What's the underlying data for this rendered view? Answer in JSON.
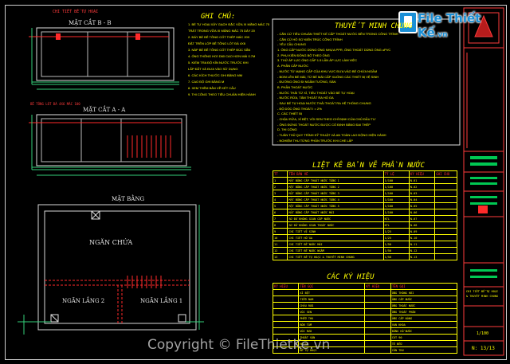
{
  "drawing": {
    "detail_heading": "CHI TIẾT BỂ TỰ HOẠI",
    "section_bb": "MẶT CẮT B - B",
    "section_aa": "MẶT CẮT A - A",
    "plan_title": "MẶT BẰNG",
    "room_main": "NGĂN CHỨA",
    "room_2": "NGĂN LẮNG 2",
    "room_1": "NGĂN LẮNG 1",
    "aa_subtitle": "BÊ TÔNG LÓT ĐÁ 4X6 MÁC 100"
  },
  "notes": {
    "heading": "GHI CHÚ:",
    "lines": [
      "1. BỂ TỰ HOẠI XÂY GẠCH ĐẶC VỮA XI MĂNG MÁC 75",
      "   TRÁT TRONG VỮA XI MĂNG MÁC 75 DÀY 20",
      "2. ĐÁY BỂ BÊ TÔNG CỐT THÉP MÁC 200",
      "   ĐẶT TRÊN LỚP BÊ TÔNG LÓT ĐÁ 4X6",
      "3. NẮP BỂ BÊ TÔNG CỐT THÉP ĐÚC SẴN",
      "4. ỐNG THÔNG HƠI D60 CAO HƠN MÁI 0.7M",
      "5. KIỂM TRA ĐỘ KÍN NƯỚC TRƯỚC KHI",
      "   LẤP ĐẤT VÀ ĐƯA VÀO SỬ DỤNG",
      "6. CÁC KÍCH THƯỚC GHI BẰNG MM",
      "7. CAO ĐỘ GHI BẰNG M",
      "8. XEM THÊM BẢN VẼ KẾT CẤU",
      "9. THI CÔNG THEO TIÊU CHUẨN HIỆN HÀNH"
    ]
  },
  "spec": {
    "heading": "THUYẾT MINH CHUNG",
    "lines": [
      "- CĂN CỨ TIÊU CHUẨN THIẾT KẾ CẤP THOÁT NƯỚC BÊN TRONG CÔNG TRÌNH",
      "- CĂN CỨ HỒ SƠ KIẾN TRÚC CÔNG TRÌNH",
      "- YÊU CẦU CHUNG",
      "1. ỐNG CẤP NƯỚC DÙNG ỐNG NHỰA PPR, ỐNG THOÁT DÙNG ỐNG uPVC",
      "2. PHỤ KIỆN ĐỒNG BỘ THEO ỐNG",
      "3. THỬ ÁP LỰC ỐNG CẤP 1.5 LẦN ÁP LỰC LÀM VIỆC",
      "A. PHẦN CẤP NƯỚC",
      "- NƯỚC TỪ MẠNG CẤP CỦA KHU VỰC ĐƯA VÀO BỂ CHỨA NGẦM",
      "- BƠM LÊN BỂ MÁI, TỪ BỂ MÁI CẤP XUỐNG CÁC THIẾT BỊ VỆ SINH",
      "- ĐƯỜNG ỐNG ĐI NGẦM TƯỜNG, SÀN",
      "B. PHẦN THOÁT NƯỚC",
      "- NƯỚC THẢI TỪ XÍ, TIỂU THOÁT VÀO BỂ TỰ HOẠI",
      "- NƯỚC RỬA, TẮM THOÁT RA HỐ GA",
      "- SAU BỂ TỰ HOẠI NƯỚC THẢI THOÁT RA HỆ THỐNG CHUNG",
      "- ĐỘ DỐC ỐNG THOÁT I = 2%",
      "C. CÁC THIẾT BỊ",
      "- CHẬU RỬA, XÍ BỆT, VÒI SEN THEO CHỈ ĐỊNH CỦA CHỦ ĐẦU TƯ",
      "- ỐNG ĐỨNG THOÁT NƯỚC ĐƯỢC CỐ ĐỊNH BẰNG ĐAI THÉP",
      "D. THI CÔNG",
      "- TUÂN THỦ QUY TRÌNH KỸ THUẬT VÀ AN TOÀN LAO ĐỘNG HIỆN HÀNH",
      "- NGHIỆM THU TỪNG PHẦN TRƯỚC KHI CHE LẤP"
    ]
  },
  "drawing_list": {
    "heading": "LIỆT KÊ BẢN VẼ PHẦN NƯỚC",
    "columns": [
      "TT",
      "TÊN BẢN VẼ",
      "TỶ LỆ",
      "KÝ HIỆU",
      "GHI CHÚ"
    ],
    "rows": [
      [
        "1",
        "MẶT BẰNG CẤP THOÁT NƯỚC TẦNG 1",
        "1/100",
        "N-01",
        ""
      ],
      [
        "2",
        "MẶT BẰNG CẤP THOÁT NƯỚC TẦNG 2",
        "1/100",
        "N-02",
        ""
      ],
      [
        "3",
        "MẶT BẰNG CẤP THOÁT NƯỚC TẦNG 3",
        "1/100",
        "N-03",
        ""
      ],
      [
        "4",
        "MẶT BẰNG CẤP THOÁT NƯỚC TẦNG 4",
        "1/100",
        "N-04",
        ""
      ],
      [
        "5",
        "MẶT BẰNG CẤP THOÁT NƯỚC TẦNG 5",
        "1/100",
        "N-05",
        ""
      ],
      [
        "6",
        "MẶT BẰNG CẤP THOÁT NƯỚC MÁI",
        "1/100",
        "N-06",
        ""
      ],
      [
        "7",
        "SƠ ĐỒ KHÔNG GIAN CẤP NƯỚC",
        "KTL",
        "N-07",
        ""
      ],
      [
        "8",
        "SƠ ĐỒ KHÔNG GIAN THOÁT NƯỚC",
        "KTL",
        "N-08",
        ""
      ],
      [
        "9",
        "CHI TIẾT VỆ SINH",
        "1/25",
        "N-09",
        ""
      ],
      [
        "10",
        "CHI TIẾT HỐ GA",
        "1/25",
        "N-10",
        ""
      ],
      [
        "11",
        "CHI TIẾT BỂ NƯỚC MÁI",
        "1/50",
        "N-11",
        ""
      ],
      [
        "12",
        "CHI TIẾT BỂ NƯỚC NGẦM",
        "1/50",
        "N-12",
        ""
      ],
      [
        "13",
        "CHI TIẾT BỂ TỰ HOẠI & THUYẾT MINH CHUNG",
        "1/50",
        "N-13",
        ""
      ]
    ]
  },
  "symbols": {
    "heading": "CÁC KÝ HIỆU",
    "columns": [
      "KÝ HIỆU",
      "TÊN GỌI",
      "KÝ HIỆU",
      "TÊN GỌI"
    ],
    "rows": [
      [
        "",
        "XÍ BỆT",
        "",
        "ỐNG THÔNG HƠI"
      ],
      [
        "",
        "TIỂU NAM",
        "",
        "ỐNG CẤP NƯỚC"
      ],
      [
        "",
        "CHẬU RỬA",
        "",
        "ỐNG THOÁT NƯỚC"
      ],
      [
        "",
        "VÒI SEN",
        "",
        "ỐNG THOÁT PHÂN"
      ],
      [
        "",
        "PHỄU THU",
        "",
        "ỐNG CẤP NÓNG"
      ],
      [
        "",
        "BỒN TẮM",
        "",
        "VAN KHÓA"
      ],
      [
        "",
        "VÒI RỬA",
        "",
        "ĐỒNG HỒ NƯỚC"
      ],
      [
        "",
        "THOÁT SÀN",
        "",
        "CÚT 90"
      ],
      [
        "",
        "HỐ GA",
        "",
        "TÊ ĐỀU"
      ],
      [
        "",
        "BỂ TỰ HOẠI",
        "",
        "CÔN THU"
      ]
    ]
  },
  "title_block": {
    "project_line1": "CHI TIẾT BỂ TỰ HOẠI",
    "project_line2": "& THUYẾT MINH CHUNG",
    "scale": "1/100",
    "sheet_no": "N: 13/13"
  },
  "branding": {
    "logo_text": "File Thiết Kế",
    "logo_suffix": ".vn",
    "watermark": "Copyright © FileThietKe.vn"
  },
  "colors": {
    "frame": "#cfcfcf",
    "text": "#ffff00",
    "pipe_red": "#ff2a2a",
    "accent_green": "#00c853",
    "brand_blue": "#1a8fd6"
  }
}
